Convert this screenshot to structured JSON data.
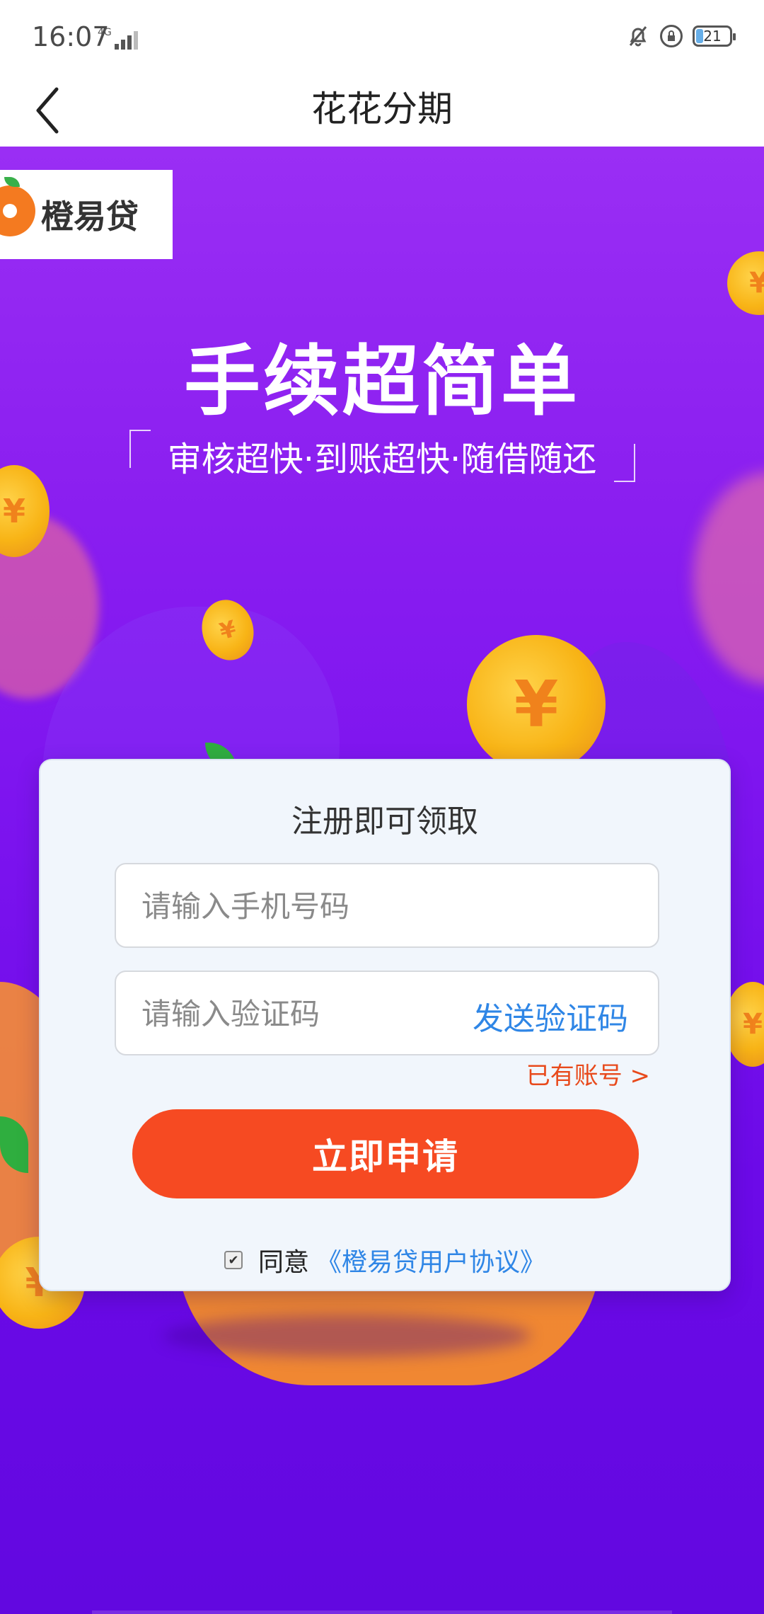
{
  "status_bar": {
    "time": "16:07",
    "network": "4G",
    "battery_level": "21"
  },
  "nav": {
    "title": "花花分期"
  },
  "brand": {
    "logo_text": "橙易贷"
  },
  "hero": {
    "title": "手续超简单",
    "subtitle": "审核超快·到账超快·随借随还"
  },
  "form": {
    "heading": "注册即可领取",
    "phone_placeholder": "请输入手机号码",
    "code_placeholder": "请输入验证码",
    "send_code_label": "发送验证码",
    "have_account_label": "已有账号 >",
    "apply_label": "立即申请",
    "agree_label": "同意",
    "agreement_link": "《橙易贷用户协议》",
    "agree_checked": true
  },
  "colors": {
    "hero_bg": "#8a1ef0",
    "primary_button": "#f64a22",
    "link_blue": "#2f86e6",
    "account_link": "#e84a1c",
    "coin": "#f8b416"
  },
  "icons": {
    "coin": "yen-coin-icon",
    "back": "chevron-left-icon"
  }
}
